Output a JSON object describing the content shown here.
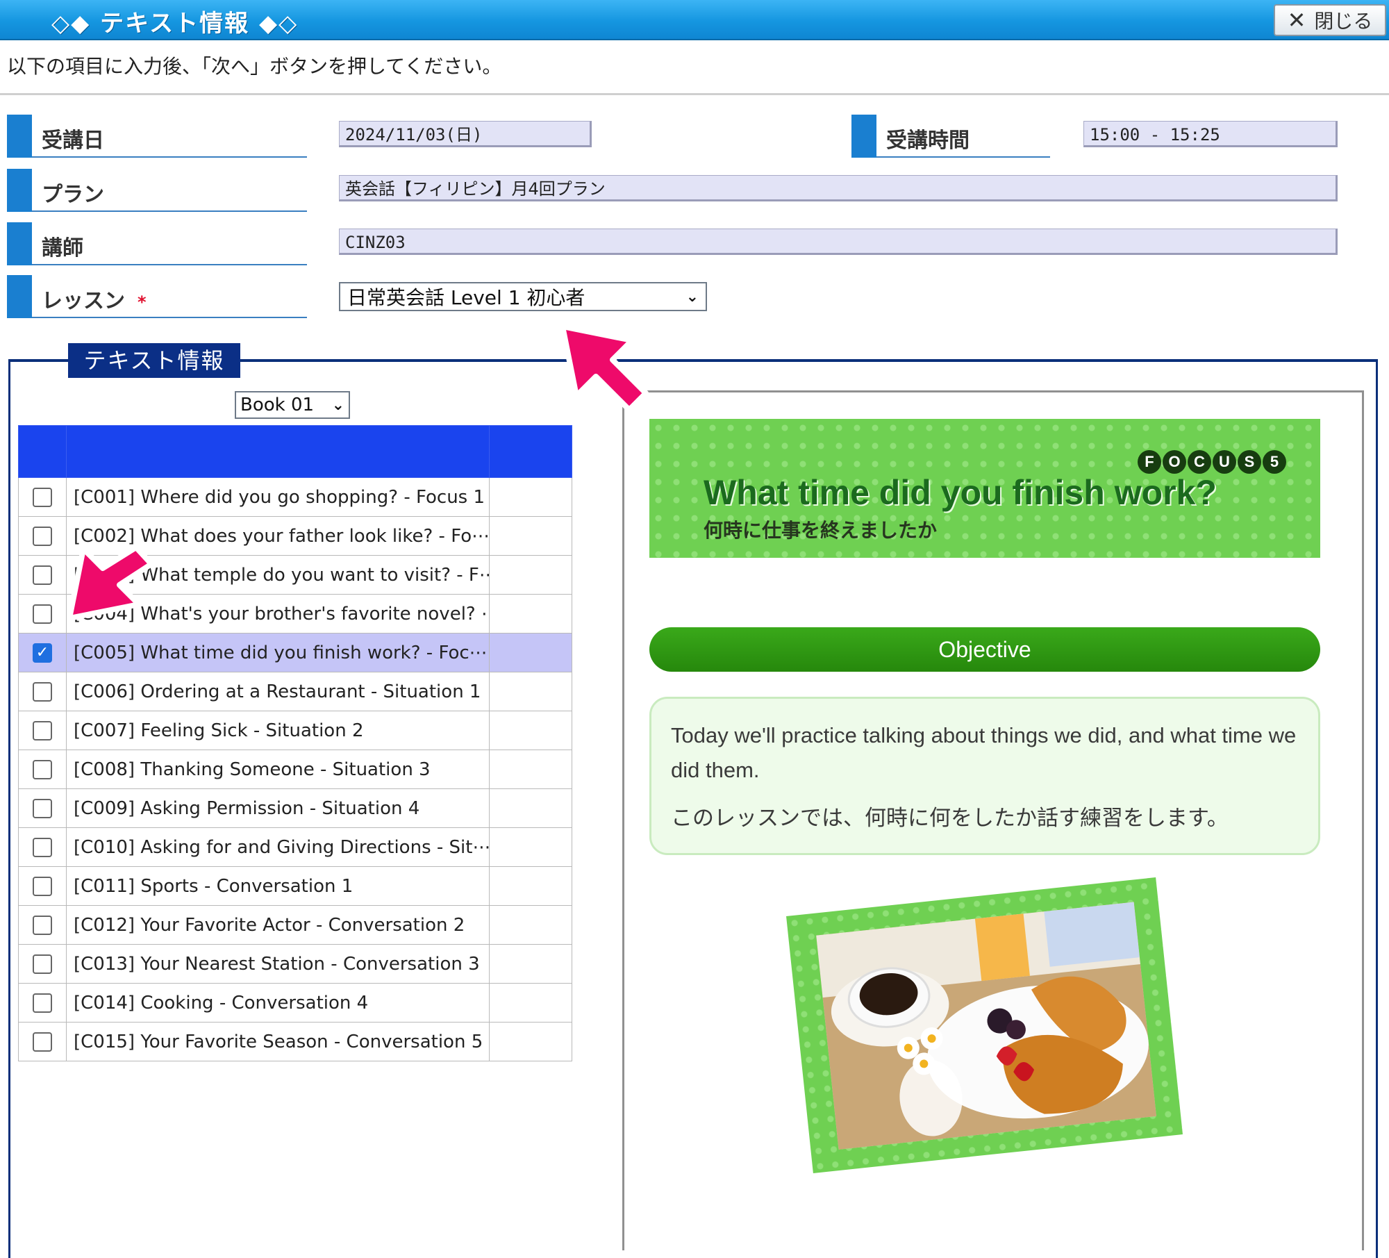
{
  "window": {
    "title": "◇◆ テキスト情報 ◆◇",
    "close_label": "閉じる"
  },
  "instruction": "以下の項目に入力後、「次へ」ボタンを押してください。",
  "form": {
    "date_label": "受講日",
    "date_value": "2024/11/03(日)",
    "time_label": "受講時間",
    "time_value": "15:00 - 15:25",
    "plan_label": "プラン",
    "plan_value": "英会話【フィリピン】月4回プラン",
    "teacher_label": "講師",
    "teacher_value": "CINZ03",
    "lesson_label": "レッスン",
    "lesson_required": "*",
    "lesson_selected": "日常英会話 Level 1 初心者"
  },
  "text_info": {
    "legend": "テキスト情報",
    "book_selected": "Book 01",
    "items": [
      {
        "label": "[C001] Where did you go shopping? - Focus 1",
        "checked": false
      },
      {
        "label": "[C002] What does your father look like? - Fo⋯",
        "checked": false
      },
      {
        "label": "[C003] What temple do you want to visit? - F⋯",
        "checked": false
      },
      {
        "label": "[C004] What's your brother's favorite novel? ⋯",
        "checked": false
      },
      {
        "label": "[C005] What time did you finish work? - Foc⋯",
        "checked": true
      },
      {
        "label": "[C006] Ordering at a Restaurant - Situation 1",
        "checked": false
      },
      {
        "label": "[C007] Feeling Sick - Situation 2",
        "checked": false
      },
      {
        "label": "[C008] Thanking Someone - Situation 3",
        "checked": false
      },
      {
        "label": "[C009] Asking Permission - Situation 4",
        "checked": false
      },
      {
        "label": "[C010] Asking for and Giving Directions - Sit⋯",
        "checked": false
      },
      {
        "label": "[C011] Sports - Conversation 1",
        "checked": false
      },
      {
        "label": "[C012] Your Favorite Actor - Conversation 2",
        "checked": false
      },
      {
        "label": "[C013] Your Nearest Station - Conversation 3",
        "checked": false
      },
      {
        "label": "[C014] Cooking - Conversation 4",
        "checked": false
      },
      {
        "label": "[C015] Your Favorite Season - Conversation 5",
        "checked": false
      }
    ]
  },
  "preview": {
    "badge": [
      "F",
      "O",
      "C",
      "U",
      "S",
      "5"
    ],
    "title": "What time did you finish work?",
    "subtitle": "何時に仕事を終えましたか",
    "objective_label": "Objective",
    "objective_en": "Today we'll practice talking about things we did, and what time we did them.",
    "objective_ja": "このレッスンでは、何時に何をしたか話す練習をします。"
  },
  "colors": {
    "titlebar": "#1596e0",
    "label_accent": "#1a7fd0",
    "legend_bg": "#0b2f86",
    "table_header": "#1a44ee",
    "selected_row": "#c5c5f7",
    "banner_green": "#6fd052",
    "objective_green": "#2a8f10",
    "arrow": "#ee0a6a"
  }
}
